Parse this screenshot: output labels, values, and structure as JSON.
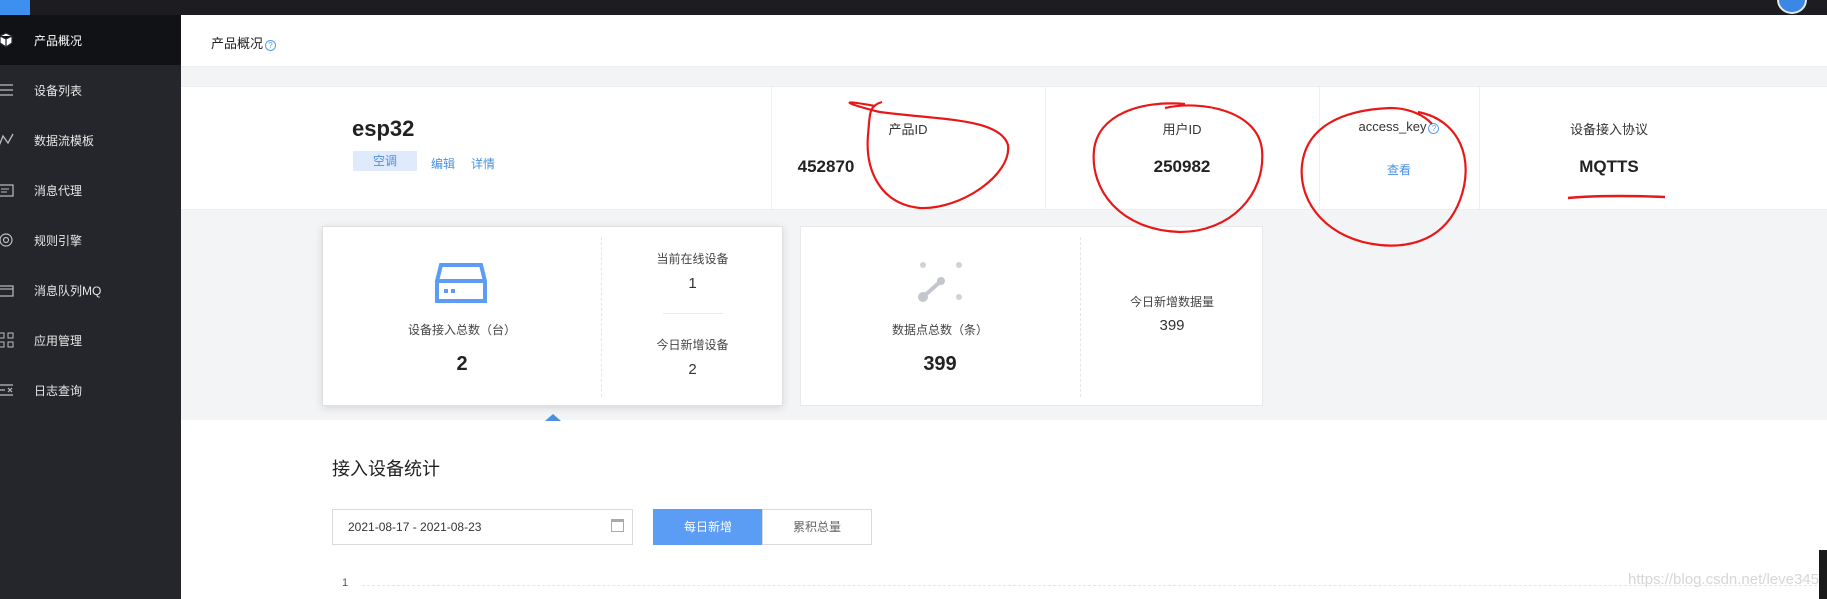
{
  "sidebar": {
    "items": [
      {
        "label": "产品概况",
        "icon": "cube-icon"
      },
      {
        "label": "设备列表",
        "icon": "list-icon"
      },
      {
        "label": "数据流模板",
        "icon": "flow-icon"
      },
      {
        "label": "消息代理",
        "icon": "message-icon"
      },
      {
        "label": "规则引擎",
        "icon": "engine-icon"
      },
      {
        "label": "消息队列MQ",
        "icon": "queue-icon"
      },
      {
        "label": "应用管理",
        "icon": "grid-icon"
      },
      {
        "label": "日志查询",
        "icon": "log-icon"
      }
    ]
  },
  "header": {
    "title": "产品概况",
    "help": "?"
  },
  "product": {
    "name": "esp32",
    "tag": "空调",
    "edit": "编辑",
    "detail": "详情"
  },
  "info": {
    "product_id_label": "产品ID",
    "product_id": "452870",
    "user_id_label": "用户ID",
    "user_id": "250982",
    "access_key_label": "access_key",
    "access_key_action": "查看",
    "protocol_label": "设备接入协议",
    "protocol": "MQTTS"
  },
  "stats": {
    "devices_total_label": "设备接入总数（台）",
    "devices_total": "2",
    "online_label": "当前在线设备",
    "online": "1",
    "new_today_label": "今日新增设备",
    "new_today": "2",
    "datapoints_label": "数据点总数（条）",
    "datapoints": "399",
    "datapoints_today_label": "今日新增数据量",
    "datapoints_today": "399"
  },
  "section": {
    "title": "接入设备统计",
    "date_range": "2021-08-17 - 2021-08-23",
    "tab_daily": "每日新增",
    "tab_total": "累积总量",
    "axis_tick": "1"
  },
  "watermark": "https://blog.csdn.net/leve345",
  "colors": {
    "accent": "#4a90e2",
    "sidebar": "#25262b",
    "annotation": "#e81818"
  }
}
